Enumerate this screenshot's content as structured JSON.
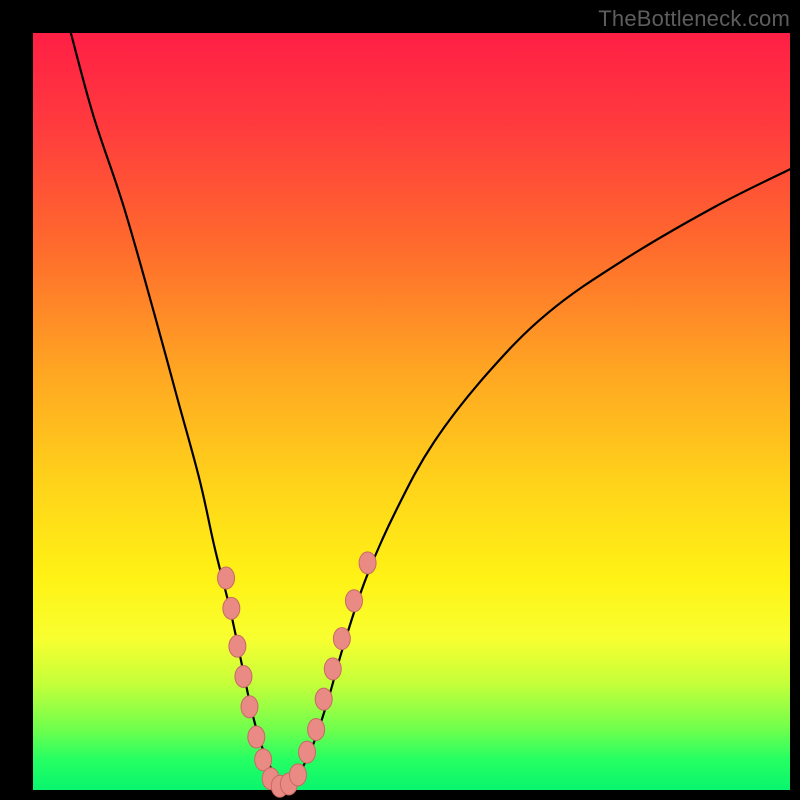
{
  "watermark": "TheBottleneck.com",
  "colors": {
    "frame": "#000000",
    "curve_stroke": "#000000",
    "marker_fill": "#e98a84",
    "marker_stroke": "#c76a64",
    "gradient_top": "#ff1f45",
    "gradient_bottom": "#09f56e"
  },
  "chart_data": {
    "type": "line",
    "title": "",
    "xlabel": "",
    "ylabel": "",
    "xlim": [
      0,
      100
    ],
    "ylim": [
      0,
      100
    ],
    "series": [
      {
        "name": "curve",
        "x": [
          5,
          8,
          12,
          16,
          19,
          22,
          24,
          26,
          27.5,
          29,
          30.5,
          32,
          33.5,
          35,
          37,
          39,
          41,
          44,
          48,
          53,
          60,
          68,
          78,
          90,
          100
        ],
        "y": [
          100,
          89,
          77,
          63,
          52,
          41,
          32,
          24,
          17,
          10,
          5,
          2,
          1,
          2,
          6,
          12,
          19,
          28,
          37,
          46,
          55,
          63,
          70,
          77,
          82
        ]
      }
    ],
    "markers": [
      {
        "x": 25.5,
        "y": 28
      },
      {
        "x": 26.2,
        "y": 24
      },
      {
        "x": 27.0,
        "y": 19
      },
      {
        "x": 27.8,
        "y": 15
      },
      {
        "x": 28.6,
        "y": 11
      },
      {
        "x": 29.5,
        "y": 7
      },
      {
        "x": 30.4,
        "y": 4
      },
      {
        "x": 31.4,
        "y": 1.5
      },
      {
        "x": 32.6,
        "y": 0.5
      },
      {
        "x": 33.8,
        "y": 0.8
      },
      {
        "x": 35.0,
        "y": 2
      },
      {
        "x": 36.2,
        "y": 5
      },
      {
        "x": 37.4,
        "y": 8
      },
      {
        "x": 38.4,
        "y": 12
      },
      {
        "x": 39.6,
        "y": 16
      },
      {
        "x": 40.8,
        "y": 20
      },
      {
        "x": 42.4,
        "y": 25
      },
      {
        "x": 44.2,
        "y": 30
      }
    ]
  }
}
